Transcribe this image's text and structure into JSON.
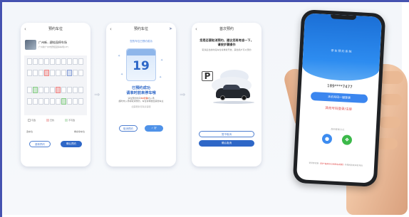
{
  "colors": {
    "frame_border": "#4653b0",
    "primary_blue": "#2e67c7",
    "login_blue": "#3b86ef",
    "accent_red": "#e04a4a"
  },
  "screen1": {
    "title": "预约车位",
    "back_icon": "chevron-left-icon",
    "lot_name": "广州新...碧桂园停车场",
    "lot_address": "广州新广州市碧桂园停车场(1F)",
    "legend": [
      "可选",
      "已约",
      "不可选"
    ],
    "info_left": "选车位",
    "info_right": "剩余停车位",
    "cancel_label": "重新预约",
    "confirm_label": "确认预约"
  },
  "screen2": {
    "title": "预约车位",
    "top_message": "您的车位已预约成功",
    "calendar_day": "19",
    "headline_1": "已预约成功",
    "headline_2": "请准时前来停车哦",
    "detail_prefix": "请在预约时间",
    "detail_highlight": "30分钟",
    "detail_suffix": "内入场",
    "detail_line2": "超时未入场将取消预约，车位将释放给其他车主",
    "note": "如需帮助可联系客服",
    "left_button": "取消预约",
    "right_button": "好"
  },
  "screen3": {
    "title": "首次预约",
    "question": "您是否要取消预约，建议您再考虑一下，请按步骤操作",
    "sub_text": "取消后当前时段车位将重新开放，其他用户可以预约",
    "sign_letter": "P",
    "secondary_button": "暂不取消",
    "primary_button": "确认取消"
  },
  "device": {
    "app_title": "停车预约系统",
    "phone_number": "189****7477",
    "one_key_login": "本机号码一键登录",
    "other_login": "其他号码登录/注册",
    "or_text": "其他登录方式",
    "social_icons": [
      "qq-icon",
      "wechat-icon"
    ],
    "agreement_prefix": "登录即同意",
    "agreement_link": "《用户服务协议和隐私政策》",
    "agreement_suffix": "并授权获取本机号码"
  }
}
